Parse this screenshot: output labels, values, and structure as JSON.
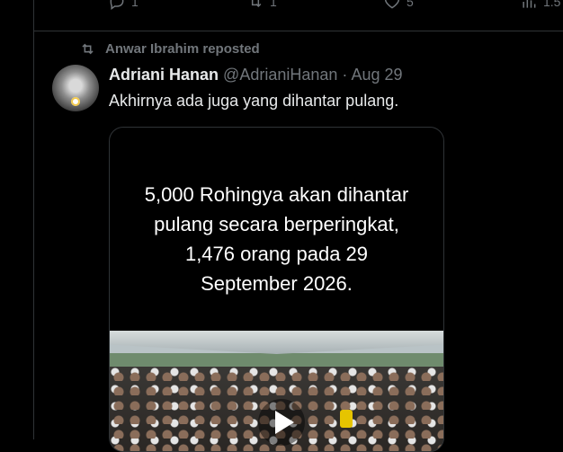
{
  "prev_tweet_actions": {
    "replies": "1",
    "reposts": "1",
    "likes": "5",
    "views": "1.5"
  },
  "social_context": "Anwar Ibrahim reposted",
  "tweet": {
    "display_name": "Adriani Hanan",
    "handle": "@AdrianiHanan",
    "separator": "·",
    "date": "Aug 29",
    "text": "Akhirnya ada juga yang dihantar pulang.",
    "media_caption_lines": [
      "5,000 Rohingya akan dihantar",
      "pulang secara berperingkat,",
      "1,476 orang pada 29",
      "September 2026."
    ]
  },
  "icons": {
    "reply": "reply-icon",
    "repost": "repost-icon",
    "like": "heart-icon",
    "views": "analytics-icon",
    "play": "play-icon"
  },
  "colors": {
    "background": "#000000",
    "text_primary": "#e7e9ea",
    "text_secondary": "#71767b",
    "border": "#2f3336"
  }
}
